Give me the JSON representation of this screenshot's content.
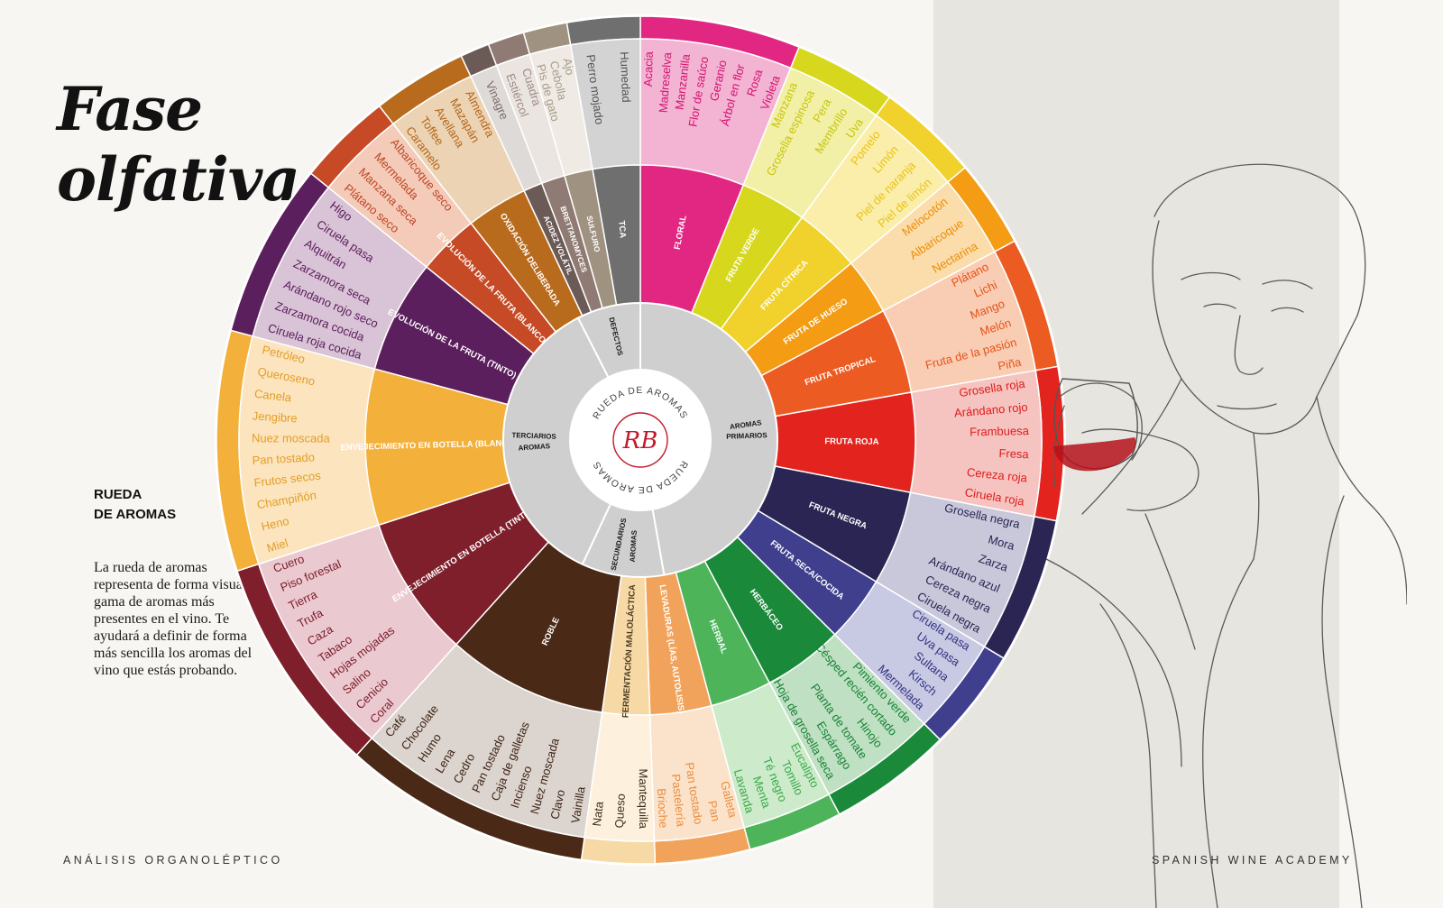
{
  "title_line1": "Fase",
  "title_line2": "olfativa",
  "subtitle_line1": "RUEDA",
  "subtitle_line2": "DE AROMAS",
  "description": "La rueda de aromas representa de forma visual la gama de aromas más presentes en el vino. Te ayudará a definir de forma más sencilla los aromas del vino que estás probando.",
  "footer_left": "ANÁLISIS ORGANOLÉPTICO",
  "footer_right": "SPANISH WINE ACADEMY",
  "center": {
    "top_text": "RUEDA DE AROMAS",
    "bottom_text": "RUEDA DE AROMAS",
    "logo": "RB"
  },
  "groups": [
    {
      "label": "AROMAS PRIMARIOS",
      "start": 0,
      "end": 170
    },
    {
      "label": "AROMAS SECUNDARIOS",
      "start": 170,
      "end": 205
    },
    {
      "label": "AROMAS TERCIARIOS",
      "start": 205,
      "end": 333
    },
    {
      "label": "DEFECTOS",
      "start": 333,
      "end": 360
    }
  ],
  "segments": [
    {
      "name": "FLORAL",
      "start": 0,
      "end": 22,
      "color": "#e22783",
      "light": "#f3b3d3",
      "text": "#ffffff",
      "items": [
        "Acacia",
        "Madreselva",
        "Manzanilla",
        "Flor de saúco",
        "Geranio",
        "Árbol en flor",
        "Rosa",
        "Violeta"
      ],
      "item_color": "#d4126f"
    },
    {
      "name": "FRUTA VERDE",
      "start": 22,
      "end": 36,
      "color": "#d7d81e",
      "light": "#f2f0a6",
      "text": "#ffffff",
      "items": [
        "Manzana",
        "Grosella espinosa",
        "Pera",
        "Membrillo",
        "Uva"
      ],
      "item_color": "#c7c50c"
    },
    {
      "name": "FRUTA CÍTRICA",
      "start": 36,
      "end": 50,
      "color": "#f1d12c",
      "light": "#faeeaa",
      "text": "#ffffff",
      "items": [
        "Pomelo",
        "Limón",
        "Piel de naranja",
        "Piel de limón"
      ],
      "item_color": "#e9c312"
    },
    {
      "name": "FRUTA DE HUESO",
      "start": 50,
      "end": 62,
      "color": "#f39c14",
      "light": "#fbdcab",
      "text": "#ffffff",
      "items": [
        "Melocotón",
        "Albaricoque",
        "Nectarina"
      ],
      "item_color": "#ec8e05"
    },
    {
      "name": "FRUTA TROPICAL",
      "start": 62,
      "end": 80,
      "color": "#ec5b21",
      "light": "#f9cdb3",
      "text": "#ffffff",
      "items": [
        "Plátano",
        "Lichi",
        "Mango",
        "Melón",
        "Fruta de la pasión",
        "Piña"
      ],
      "item_color": "#e6521b"
    },
    {
      "name": "FRUTA ROJA",
      "start": 80,
      "end": 101,
      "color": "#e2231e",
      "light": "#f6c4c0",
      "text": "#ffffff",
      "items": [
        "Grosella roja",
        "Arándano rojo",
        "Frambuesa",
        "Fresa",
        "Cereza roja",
        "Ciruela roja"
      ],
      "item_color": "#dd1c1b"
    },
    {
      "name": "FRUTA NEGRA",
      "start": 101,
      "end": 121,
      "color": "#2b2553",
      "light": "#c9c8db",
      "text": "#ffffff",
      "items": [
        "Grosella negra",
        "Mora",
        "Zarza",
        "Arándano azul",
        "Cereza negra",
        "Ciruela negra"
      ],
      "item_color": "#29234f"
    },
    {
      "name": "FRUTA SECA/COCIDA",
      "start": 121,
      "end": 135,
      "color": "#3f3f8e",
      "light": "#c8c9e3",
      "text": "#ffffff",
      "items": [
        "Ciruela pasa",
        "Uva pasa",
        "Sultana",
        "Kirsch",
        "Mermelada"
      ],
      "item_color": "#333380"
    },
    {
      "name": "HERBÁCEO",
      "start": 135,
      "end": 152,
      "color": "#1a8a3a",
      "light": "#bfe0c2",
      "text": "#ffffff",
      "items": [
        "Pimiento verde",
        "Césped recién cortado",
        "Hinojo",
        "Planta de tomate",
        "Espárrago",
        "Hoja de grosella seca"
      ],
      "item_color": "#168236"
    },
    {
      "name": "HERBAL",
      "start": 152,
      "end": 165,
      "color": "#4db45a",
      "light": "#cdebcb",
      "text": "#ffffff",
      "items": [
        "Eucalipto",
        "Tomillo",
        "Té negro",
        "Menta",
        "Lavanda"
      ],
      "item_color": "#3aa848"
    },
    {
      "name": "LEVADURAS (LÍAS, AUTOLISIS)",
      "start": 165,
      "end": 178,
      "color": "#f2a35b",
      "light": "#fbe3cb",
      "text": "#ffffff",
      "items": [
        "Galleta",
        "Pan",
        "Pan tostado",
        "Pastelería",
        "Brioche"
      ],
      "item_color": "#eb8d3c"
    },
    {
      "name": "FERMENTACIÓN MALOLÁCTICA",
      "start": 178,
      "end": 188,
      "color": "#f7d9a6",
      "light": "#fdf1dd",
      "text": "#4a3a20",
      "items": [
        "Mantequilla",
        "Queso",
        "Nata"
      ],
      "item_color": "#3a2e1e"
    },
    {
      "name": "ROBLE",
      "start": 188,
      "end": 222,
      "color": "#4b2917",
      "light": "#dcd4cf",
      "text": "#ffffff",
      "items": [
        "Vainilla",
        "Clavo",
        "Nuez moscada",
        "Incienso",
        "Caja de galletas",
        "Pan tostado",
        "Cedro",
        "Lena",
        "Humo",
        "Chocolate",
        "Café"
      ],
      "item_color": "#3d2415"
    },
    {
      "name": "ENVEJECIMIENTO EN BOTELLA (TINTO)",
      "start": 222,
      "end": 252,
      "color": "#7e1f2b",
      "light": "#ebc9d0",
      "text": "#ffffff",
      "items": [
        "Coral",
        "Cenicio",
        "Salino",
        "Hojas mojadas",
        "Tabaco",
        "Caza",
        "Trufa",
        "Tierra",
        "Piso forestal",
        "Cuero"
      ],
      "item_color": "#7a1c28"
    },
    {
      "name": "ENVEJECIMIENTO EN BOTELLA (BLANCO)",
      "start": 252,
      "end": 285,
      "color": "#f3b03a",
      "light": "#fce4be",
      "text": "#ffffff",
      "items": [
        "Miel",
        "Heno",
        "Champiñón",
        "Frutos secos",
        "Pan tostado",
        "Nuez moscada",
        "Jengibre",
        "Canela",
        "Queroseno",
        "Petróleo"
      ],
      "item_color": "#e29e27"
    },
    {
      "name": "EVOLUCIÓN DE LA FRUTA (TINTO)",
      "start": 285,
      "end": 309,
      "color": "#5c1f5d",
      "light": "#d9c3d6",
      "text": "#ffffff",
      "items": [
        "Ciruela roja cocida",
        "Zarzamora cocida",
        "Arándano rojo seco",
        "Zarzamora seca",
        "Alquitrán",
        "Ciruela pasa",
        "Higo"
      ],
      "item_color": "#5a1c5b"
    },
    {
      "name": "EVOLUCIÓN DE LA FRUTA (BLANCO)",
      "start": 309,
      "end": 322,
      "color": "#c64a26",
      "light": "#f4cbb8",
      "text": "#ffffff",
      "items": [
        "Plátano seco",
        "Manzana seca",
        "Mermelada",
        "Albaricoque seco"
      ],
      "item_color": "#bf4424"
    },
    {
      "name": "OXIDACIÓN DELIBERADA",
      "start": 322,
      "end": 335,
      "color": "#b86b1d",
      "light": "#ecd3b3",
      "text": "#ffffff",
      "items": [
        "Caramelo",
        "Toffee",
        "Avellana",
        "Mazapán",
        "Almendra"
      ],
      "item_color": "#b2661a"
    },
    {
      "name": "ACIDEZ VOLÁTIL",
      "start": 335,
      "end": 339,
      "color": "#6b5a56",
      "light": "#dedad8",
      "text": "#ffffff",
      "items": [
        "Vinagre"
      ],
      "item_color": "#7b6c68"
    },
    {
      "name": "BRETTANOMYCES",
      "start": 339,
      "end": 344,
      "color": "#8f7b73",
      "light": "#ebe5e1",
      "text": "#ffffff",
      "items": [
        "Estiércol",
        "Cuadra"
      ],
      "item_color": "#9e8b83"
    },
    {
      "name": "SULFURO",
      "start": 344,
      "end": 350,
      "color": "#a09280",
      "light": "#efebe4",
      "text": "#ffffff",
      "items": [
        "Pis de gato",
        "Cebolla",
        "Ajo"
      ],
      "item_color": "#a89a8b"
    },
    {
      "name": "TCA",
      "start": 350,
      "end": 360,
      "color": "#6f6f6f",
      "light": "#d3d3d3",
      "text": "#ffffff",
      "items": [
        "Perro mojado",
        "Humedad"
      ],
      "item_color": "#555555"
    }
  ]
}
